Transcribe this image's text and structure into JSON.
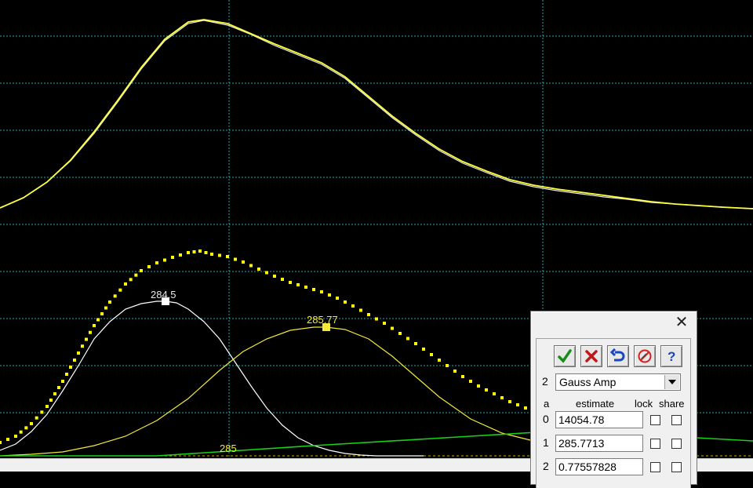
{
  "chart_data": {
    "type": "line",
    "xlabel": "",
    "ylabel": "",
    "grid": true,
    "grid_color": "#1aa7a7",
    "background": "#000000",
    "x_tick_labels": [
      "285"
    ],
    "series": [
      {
        "role": "spectrum",
        "color": "#e8e8e8",
        "x": [
          0,
          30,
          60,
          90,
          120,
          150,
          180,
          210,
          240,
          260,
          290,
          320,
          350,
          380,
          410,
          440,
          470,
          500,
          530,
          560,
          590,
          620,
          650,
          680,
          710,
          740,
          770,
          800,
          830,
          860,
          890,
          920,
          960
        ],
        "y": [
          265,
          252,
          232,
          205,
          170,
          130,
          88,
          52,
          30,
          26,
          32,
          44,
          58,
          70,
          82,
          100,
          125,
          150,
          172,
          192,
          208,
          220,
          231,
          238,
          243,
          247,
          251,
          254,
          258,
          260,
          262,
          264,
          266
        ]
      },
      {
        "role": "fit-envelope",
        "color": "#ffff40",
        "x": [
          0,
          30,
          60,
          90,
          120,
          150,
          180,
          210,
          240,
          260,
          290,
          320,
          350,
          380,
          410,
          440,
          470,
          500,
          530,
          560,
          590,
          620,
          650,
          680,
          710,
          740,
          770,
          800,
          830,
          860,
          890,
          920,
          960
        ],
        "y": [
          265,
          252,
          232,
          204,
          168,
          128,
          86,
          50,
          28,
          25,
          30,
          43,
          56,
          68,
          80,
          98,
          123,
          148,
          170,
          190,
          206,
          218,
          229,
          236,
          241,
          245,
          249,
          253,
          257,
          260,
          262,
          264,
          266
        ]
      },
      {
        "role": "peak-1",
        "color": "#ffffff",
        "center_label": "284.5",
        "x": [
          0,
          20,
          40,
          60,
          80,
          100,
          120,
          140,
          160,
          180,
          200,
          211,
          225,
          240,
          260,
          280,
          300,
          320,
          340,
          360,
          380,
          400,
          420,
          440,
          460,
          480,
          500,
          520,
          540
        ],
        "y": [
          574,
          566,
          550,
          528,
          498,
          466,
          432,
          410,
          394,
          387,
          384,
          384,
          386,
          394,
          410,
          432,
          462,
          492,
          520,
          542,
          558,
          568,
          574,
          578,
          580,
          581,
          581,
          581,
          581
        ]
      },
      {
        "role": "peak-2",
        "color": "#f2ea3a",
        "center_label": "285.77",
        "x": [
          0,
          40,
          80,
          120,
          160,
          200,
          240,
          280,
          310,
          340,
          370,
          400,
          416,
          440,
          470,
          500,
          530,
          560,
          600,
          640,
          680
        ],
        "y": [
          581,
          579,
          576,
          568,
          556,
          536,
          508,
          472,
          448,
          432,
          421,
          417,
          417,
          420,
          432,
          454,
          480,
          506,
          534,
          552,
          562
        ]
      },
      {
        "role": "sum-dotted",
        "color": "#ffff00",
        "x": [
          0,
          20,
          40,
          60,
          80,
          100,
          120,
          140,
          160,
          180,
          200,
          220,
          240,
          255,
          270,
          290,
          310,
          330,
          350,
          370,
          390,
          410,
          430,
          450,
          470,
          490,
          510,
          530,
          550,
          570,
          590,
          610,
          630,
          650,
          670,
          690,
          710,
          730,
          750,
          770,
          790,
          810,
          830,
          850,
          870,
          890,
          910,
          930,
          950,
          960
        ],
        "y": [
          564,
          556,
          540,
          518,
          486,
          450,
          415,
          385,
          362,
          345,
          335,
          328,
          322,
          320,
          324,
          327,
          334,
          343,
          352,
          360,
          366,
          372,
          380,
          390,
          401,
          412,
          425,
          438,
          452,
          466,
          480,
          492,
          502,
          512,
          520,
          526,
          532,
          538,
          542,
          546,
          550,
          553,
          556,
          558,
          560,
          562,
          563,
          564,
          565,
          565
        ]
      },
      {
        "role": "background",
        "color": "#18d018",
        "x": [
          0,
          200,
          400,
          600,
          700,
          800,
          960
        ],
        "y": [
          581,
          581,
          568,
          556,
          550,
          553,
          562
        ]
      }
    ]
  },
  "dialog": {
    "row_index": "2",
    "function_select": "Gauss Amp",
    "headers": {
      "a": "a",
      "estimate": "estimate",
      "lock": "lock",
      "share": "share"
    },
    "params": [
      {
        "index": "0",
        "estimate": "14054.78"
      },
      {
        "index": "1",
        "estimate": "285.7713"
      },
      {
        "index": "2",
        "estimate": "0.77557828"
      }
    ],
    "icons": [
      "check-icon",
      "x-icon",
      "undo-icon",
      "no-edit-icon",
      "help-icon"
    ]
  }
}
